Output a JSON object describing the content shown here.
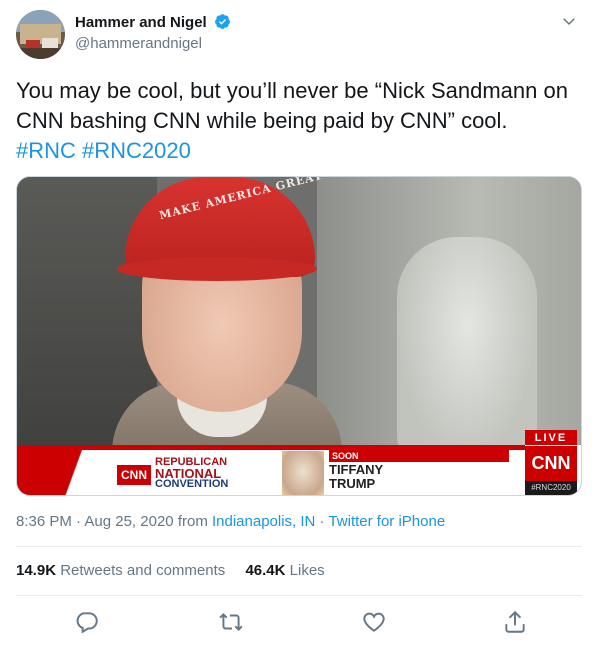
{
  "tweet": {
    "display_name": "Hammer and Nigel",
    "handle": "@hammerandnigel",
    "text_before": "You may be cool, but you’ll never be “Nick Sandmann on CNN bashing CNN while being paid by CNN” cool.",
    "hashtags": [
      "#RNC",
      "#RNC2020"
    ]
  },
  "media": {
    "cap_text": "MAKE AMERICA GREAT",
    "live_badge": "LIVE",
    "cnn_small": "CNN",
    "rnc_line1": "REPUBLICAN",
    "rnc_line2": "NATIONAL",
    "rnc_line3": "CONVENTION",
    "soon_label": "SOON",
    "speaker_first": "TIFFANY",
    "speaker_last": "TRUMP",
    "cnn_big": "CNN",
    "watermark": "#RNC2020"
  },
  "meta": {
    "time": "8:36 PM",
    "date": "Aug 25, 2020",
    "from_label": "from",
    "location": "Indianapolis, IN",
    "source": "Twitter for iPhone"
  },
  "stats": {
    "retweets_count": "14.9K",
    "retweets_label": "Retweets and comments",
    "likes_count": "46.4K",
    "likes_label": "Likes"
  },
  "colors": {
    "link": "#1b95e0",
    "verified": "#1da1f2",
    "muted": "#657786",
    "cnn_red": "#cc0000"
  },
  "icons": [
    "verified-badge-icon",
    "chevron-down-icon",
    "reply-icon",
    "retweet-icon",
    "like-icon",
    "share-icon"
  ]
}
